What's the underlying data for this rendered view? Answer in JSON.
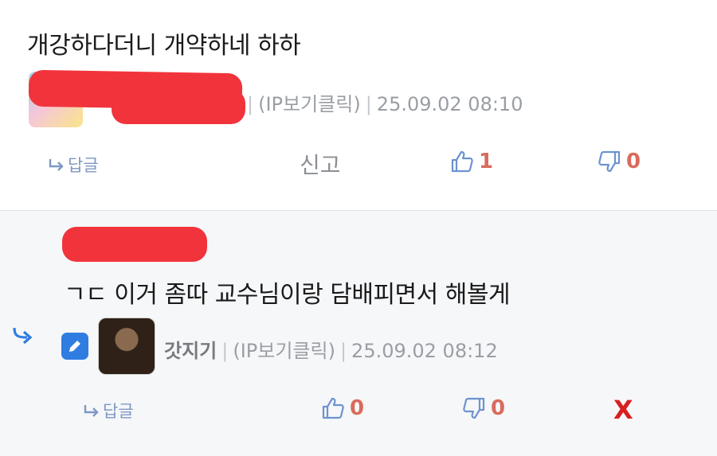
{
  "comment1": {
    "text": "개강하다더니 개약하네 하하",
    "ip_label": "(IP보기클릭)",
    "datetime": "25.09.02 08:10",
    "reply_label": "답글",
    "report_label": "신고",
    "likes": "1",
    "dislikes": "0"
  },
  "comment2": {
    "text": "ㄱㄷ 이거 좀따 교수님이랑 담배피면서 해볼게",
    "nickname": "갓지기",
    "ip_label": "(IP보기클릭)",
    "datetime": "25.09.02 08:12",
    "reply_label": "답글",
    "likes": "0",
    "dislikes": "0",
    "delete_label": "X"
  },
  "separator": "|",
  "icons": [
    "reply-arrow-icon",
    "thumbs-up-icon",
    "thumbs-down-icon",
    "nested-reply-arrow-icon",
    "pencil-icon"
  ],
  "colors": {
    "accent": "#2f7de1",
    "count": "#d96b5c",
    "delete": "#d82020",
    "redaction": "#f1343c"
  }
}
